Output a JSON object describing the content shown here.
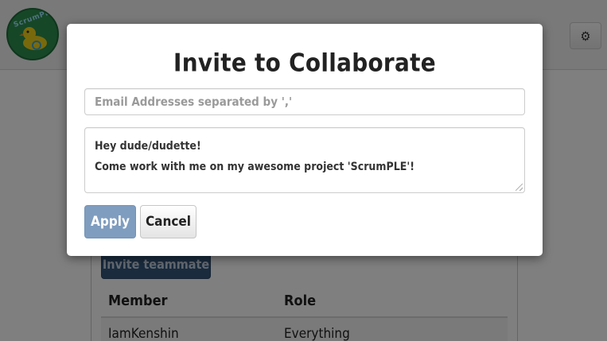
{
  "app": {
    "logo_text": "ScrumPLE",
    "brand_color": "#2d8f4e",
    "settings_icon": "gear-icon"
  },
  "team": {
    "invite_button_label": "Invite teammate",
    "columns": [
      "Member",
      "Role"
    ],
    "rows": [
      {
        "member": "IamKenshin",
        "role": "Everything"
      }
    ]
  },
  "modal": {
    "title": "Invite to Collaborate",
    "email_placeholder": "Email Addresses separated by ','",
    "email_value": "",
    "message_value": "Hey dude/dudette!\nCome work with me on my awesome project 'ScrumPLE'!",
    "apply_label": "Apply",
    "cancel_label": "Cancel",
    "apply_color": "#7f9dbf"
  }
}
